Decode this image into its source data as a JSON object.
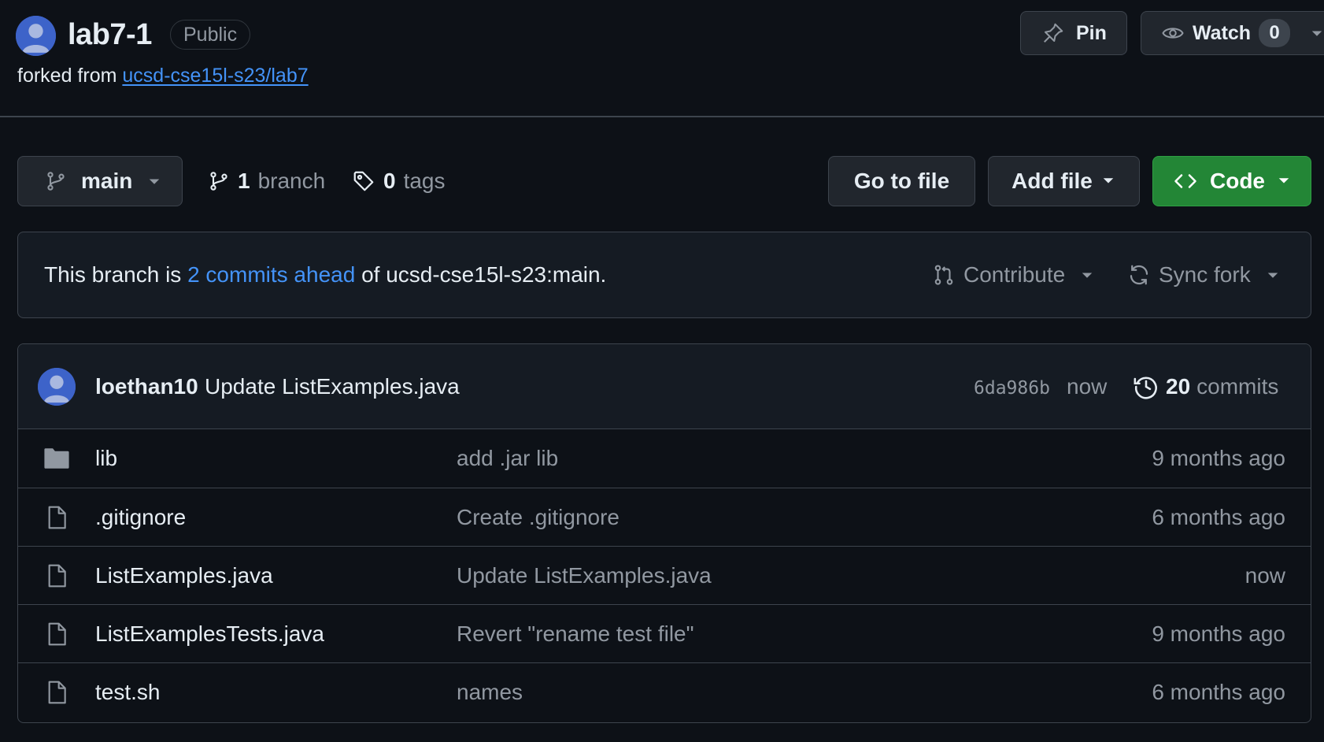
{
  "repo": {
    "name": "lab7-1",
    "visibility": "Public",
    "forked_prefix": "forked from",
    "forked_link": "ucsd-cse15l-s23/lab7"
  },
  "actions": {
    "pin_label": "Pin",
    "watch_label": "Watch",
    "watch_count": "0"
  },
  "toolbar": {
    "branch": "main",
    "branch_count": "1",
    "branch_label": "branch",
    "tag_count": "0",
    "tag_label": "tags",
    "go_to_file": "Go to file",
    "add_file": "Add file",
    "code": "Code"
  },
  "fork_status": {
    "prefix": "This branch is",
    "link": "2 commits ahead",
    "suffix": "of ucsd-cse15l-s23:main.",
    "contribute": "Contribute",
    "sync_fork": "Sync fork"
  },
  "latest_commit": {
    "author": "loethan10",
    "message": "Update ListExamples.java",
    "sha": "6da986b",
    "time": "now",
    "commit_count": "20",
    "commit_label": "commits"
  },
  "files": [
    {
      "type": "folder",
      "name": "lib",
      "message": "add .jar lib",
      "date": "9 months ago"
    },
    {
      "type": "file",
      "name": ".gitignore",
      "message": "Create .gitignore",
      "date": "6 months ago"
    },
    {
      "type": "file",
      "name": "ListExamples.java",
      "message": "Update ListExamples.java",
      "date": "now"
    },
    {
      "type": "file",
      "name": "ListExamplesTests.java",
      "message": "Revert \"rename test file\"",
      "date": "9 months ago"
    },
    {
      "type": "file",
      "name": "test.sh",
      "message": "names",
      "date": "6 months ago"
    }
  ],
  "colors": {
    "background": "#0d1117",
    "link": "#4493f8",
    "code_button": "#238636",
    "muted": "#9198a1"
  }
}
